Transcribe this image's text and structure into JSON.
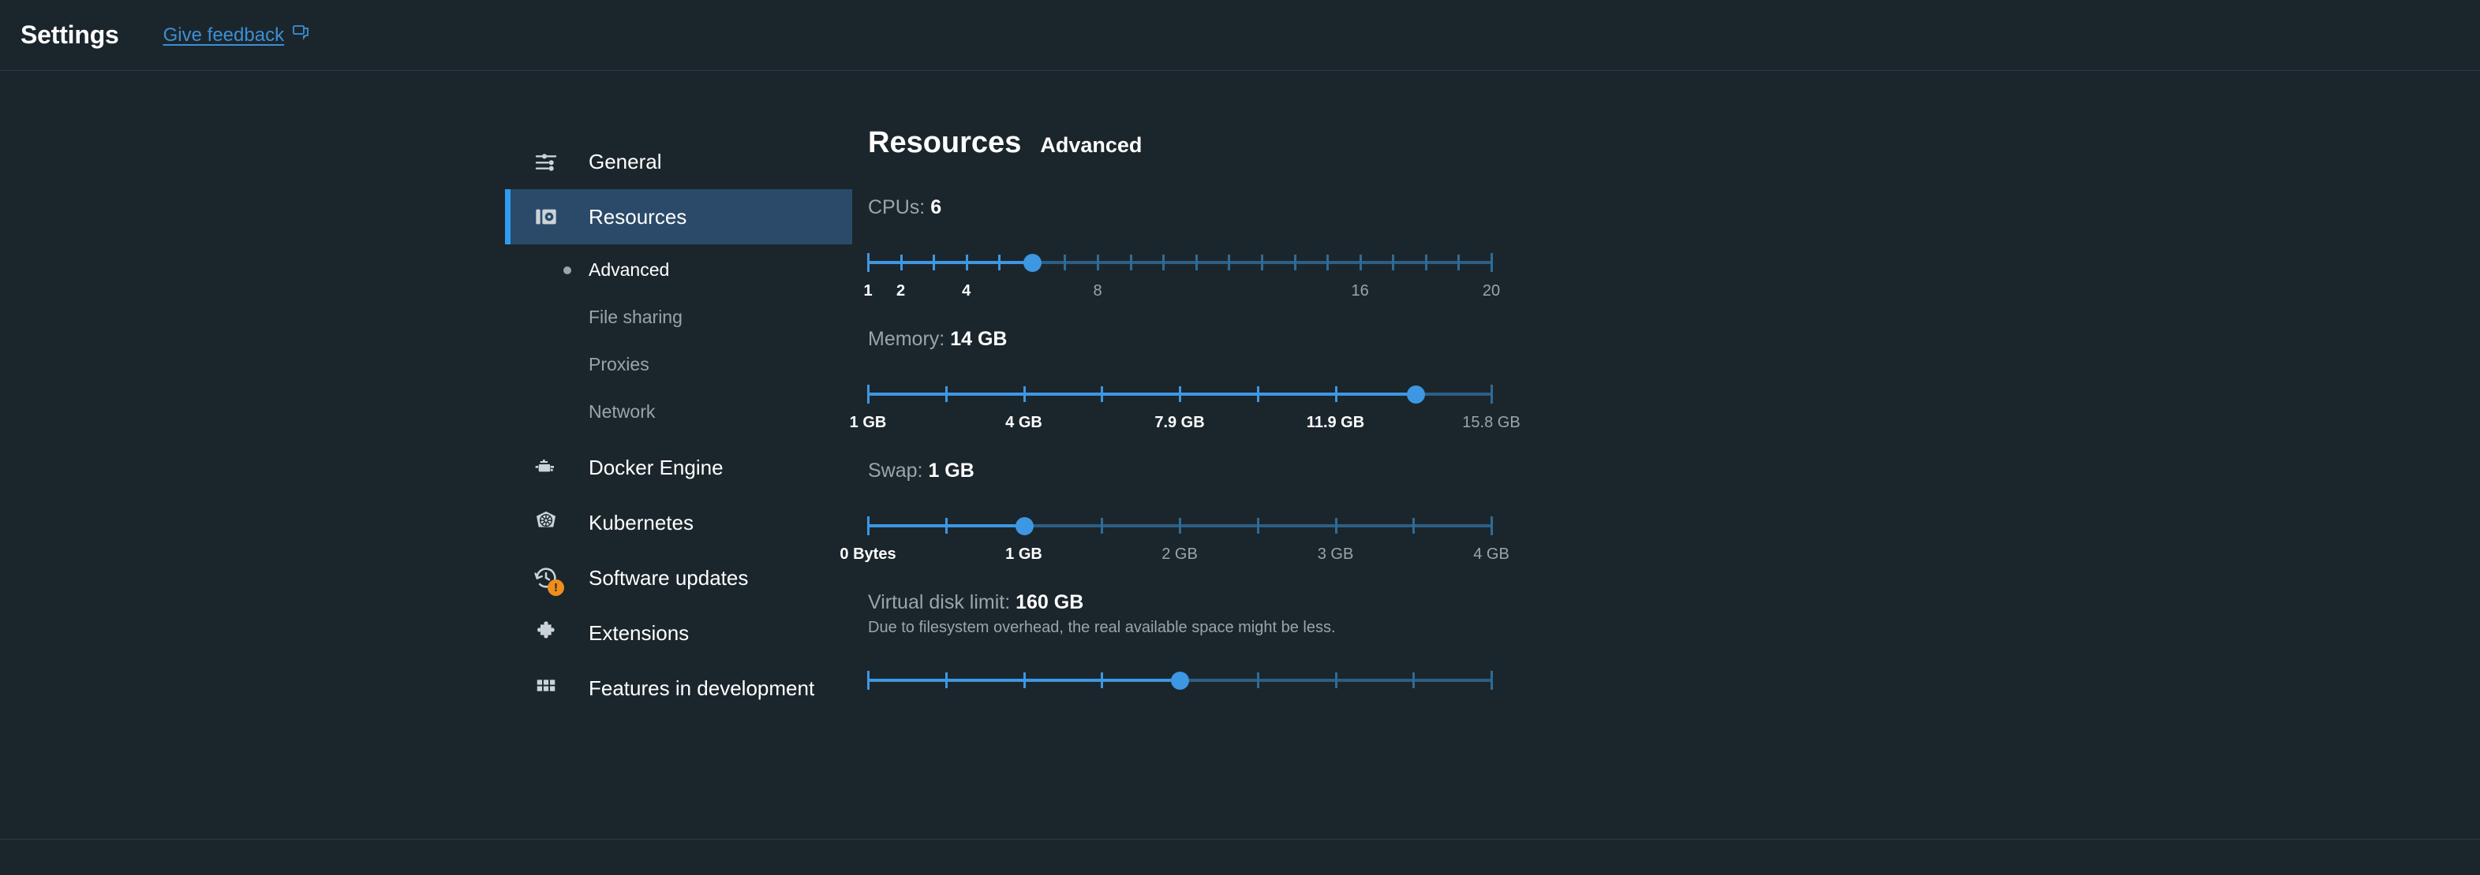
{
  "header": {
    "app_title": "Settings",
    "feedback_label": "Give feedback",
    "feedback_icon": "feedback-chat-icon",
    "link_color": "#3d8fd5"
  },
  "sidebar": {
    "items": [
      {
        "label": "General",
        "icon": "tune-sliders-icon",
        "active": false
      },
      {
        "label": "Resources",
        "icon": "resources-disk-icon",
        "active": true
      },
      {
        "label": "Docker Engine",
        "icon": "docker-engine-icon",
        "active": false
      },
      {
        "label": "Kubernetes",
        "icon": "kubernetes-helm-icon",
        "active": false
      },
      {
        "label": "Software updates",
        "icon": "history-clock-icon",
        "active": false,
        "badge": "!"
      },
      {
        "label": "Extensions",
        "icon": "puzzle-piece-icon",
        "active": false
      },
      {
        "label": "Features in development",
        "icon": "grid-squares-icon",
        "active": false
      }
    ],
    "sub_items": [
      {
        "label": "Advanced",
        "active": true
      },
      {
        "label": "File sharing",
        "active": false
      },
      {
        "label": "Proxies",
        "active": false
      },
      {
        "label": "Network",
        "active": false
      }
    ],
    "active_color": "#2b4a69",
    "accent_color": "#2f9cf1",
    "badge_color": "#ef8d1d"
  },
  "main": {
    "title": "Resources",
    "subtitle": "Advanced",
    "cpus": {
      "label": "CPUs:",
      "value": "6",
      "min": 1,
      "max": 20,
      "current": 6,
      "tick_count": 20,
      "scale": [
        {
          "text": "1",
          "tick": 0,
          "bright": true
        },
        {
          "text": "2",
          "tick": 1,
          "bright": true
        },
        {
          "text": "4",
          "tick": 3,
          "bright": true
        },
        {
          "text": "8",
          "tick": 7,
          "bright": false
        },
        {
          "text": "16",
          "tick": 15,
          "bright": false
        },
        {
          "text": "20",
          "tick": 19,
          "bright": false
        }
      ]
    },
    "memory": {
      "label": "Memory:",
      "value": "14 GB",
      "min": 1,
      "max": 15.8,
      "current": 14,
      "tick_count": 9,
      "scale": [
        {
          "text": "1 GB",
          "tick": 0,
          "bright": true
        },
        {
          "text": "4 GB",
          "tick": 2,
          "bright": true
        },
        {
          "text": "7.9 GB",
          "tick": 4,
          "bright": true
        },
        {
          "text": "11.9 GB",
          "tick": 6,
          "bright": true
        },
        {
          "text": "15.8 GB",
          "tick": 8,
          "bright": false
        }
      ]
    },
    "swap": {
      "label": "Swap:",
      "value": "1 GB",
      "min": 0,
      "max": 4,
      "current": 1,
      "tick_count": 9,
      "scale": [
        {
          "text": "0 Bytes",
          "tick": 0,
          "bright": true
        },
        {
          "text": "1 GB",
          "tick": 2,
          "bright": true
        },
        {
          "text": "2 GB",
          "tick": 4,
          "bright": false
        },
        {
          "text": "3 GB",
          "tick": 6,
          "bright": false
        },
        {
          "text": "4 GB",
          "tick": 8,
          "bright": false
        }
      ]
    },
    "disk": {
      "label": "Virtual disk limit:",
      "value": "160 GB",
      "hint": "Due to filesystem overhead, the real available space might be less.",
      "tick_count": 9,
      "current_tick": 4
    },
    "track_color": "#2b5f86",
    "fill_color": "#3d97e3"
  }
}
